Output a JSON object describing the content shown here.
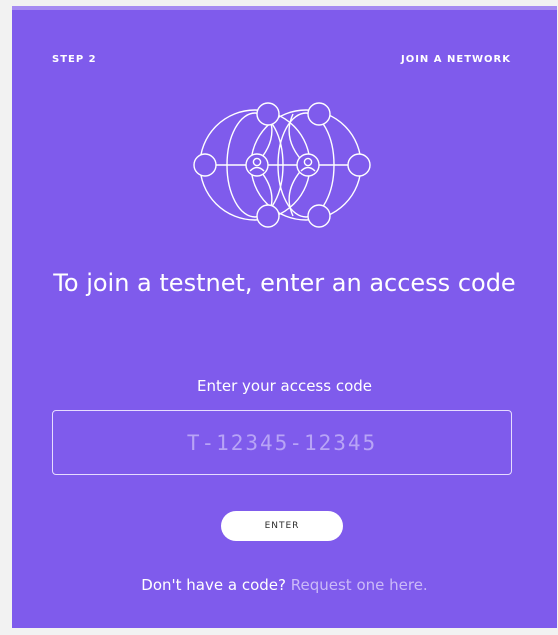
{
  "header": {
    "step": "STEP 2",
    "section": "JOIN A NETWORK"
  },
  "illustration": {
    "icon": "network-nodes-icon"
  },
  "main": {
    "headline": "To join a testnet, enter an access code",
    "field_label": "Enter your access code",
    "code_placeholder": "T-12345-12345",
    "enter_label": "ENTER"
  },
  "footer": {
    "prompt": "Don't have a code?",
    "link_text": "Request one here."
  },
  "colors": {
    "card_background": "#7f5bec",
    "link": "#cbbaf8"
  }
}
